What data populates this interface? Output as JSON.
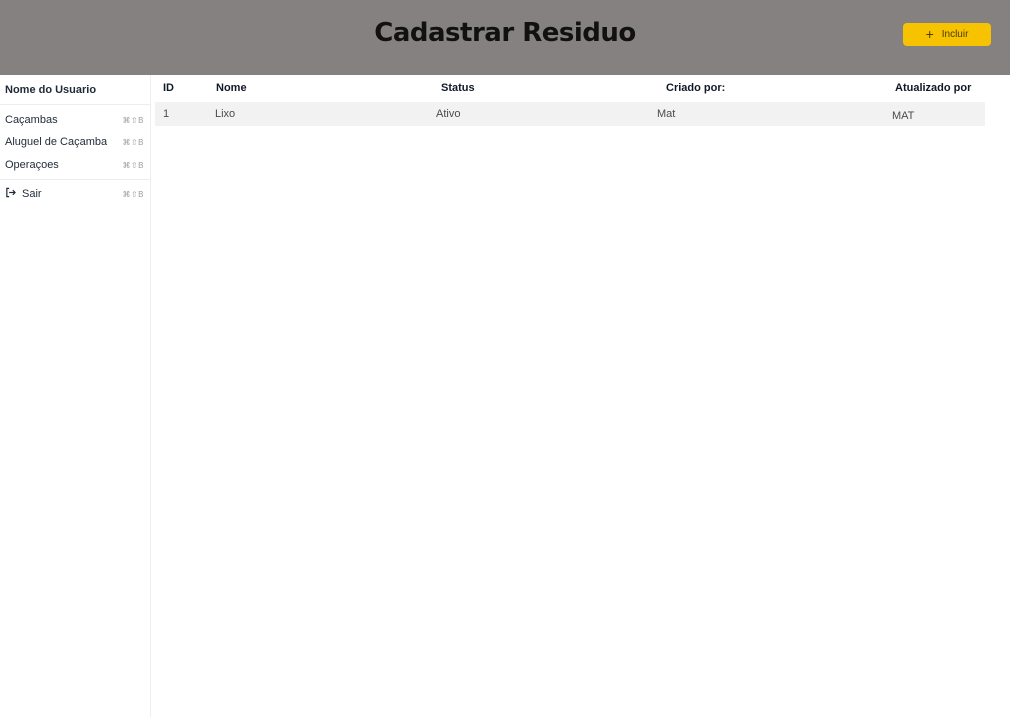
{
  "header": {
    "title": "Cadastrar Residuo",
    "add_button": {
      "icon": "plus-icon",
      "label": "Incluir"
    }
  },
  "sidebar": {
    "user_name": "Nome do Usuario",
    "items": [
      {
        "label": "Caçambas",
        "shortcut": "⌘⇧B"
      },
      {
        "label": "Aluguel de Caçamba",
        "shortcut": "⌘⇧B"
      },
      {
        "label": "Operaçoes",
        "shortcut": "⌘⇧B"
      }
    ],
    "logout": {
      "icon": "logout-icon",
      "label": "Sair",
      "shortcut": "⌘⇧B"
    }
  },
  "table": {
    "columns": [
      "ID",
      "Nome",
      "Status",
      "Criado por:",
      "Atualizado por"
    ],
    "rows": [
      [
        "1",
        "Lixo",
        "Ativo",
        "Mat",
        "MAT"
      ]
    ]
  },
  "colors": {
    "header_bg": "#858180",
    "button_accent": "#f7c300",
    "row_bg": "#f2f2f2"
  }
}
